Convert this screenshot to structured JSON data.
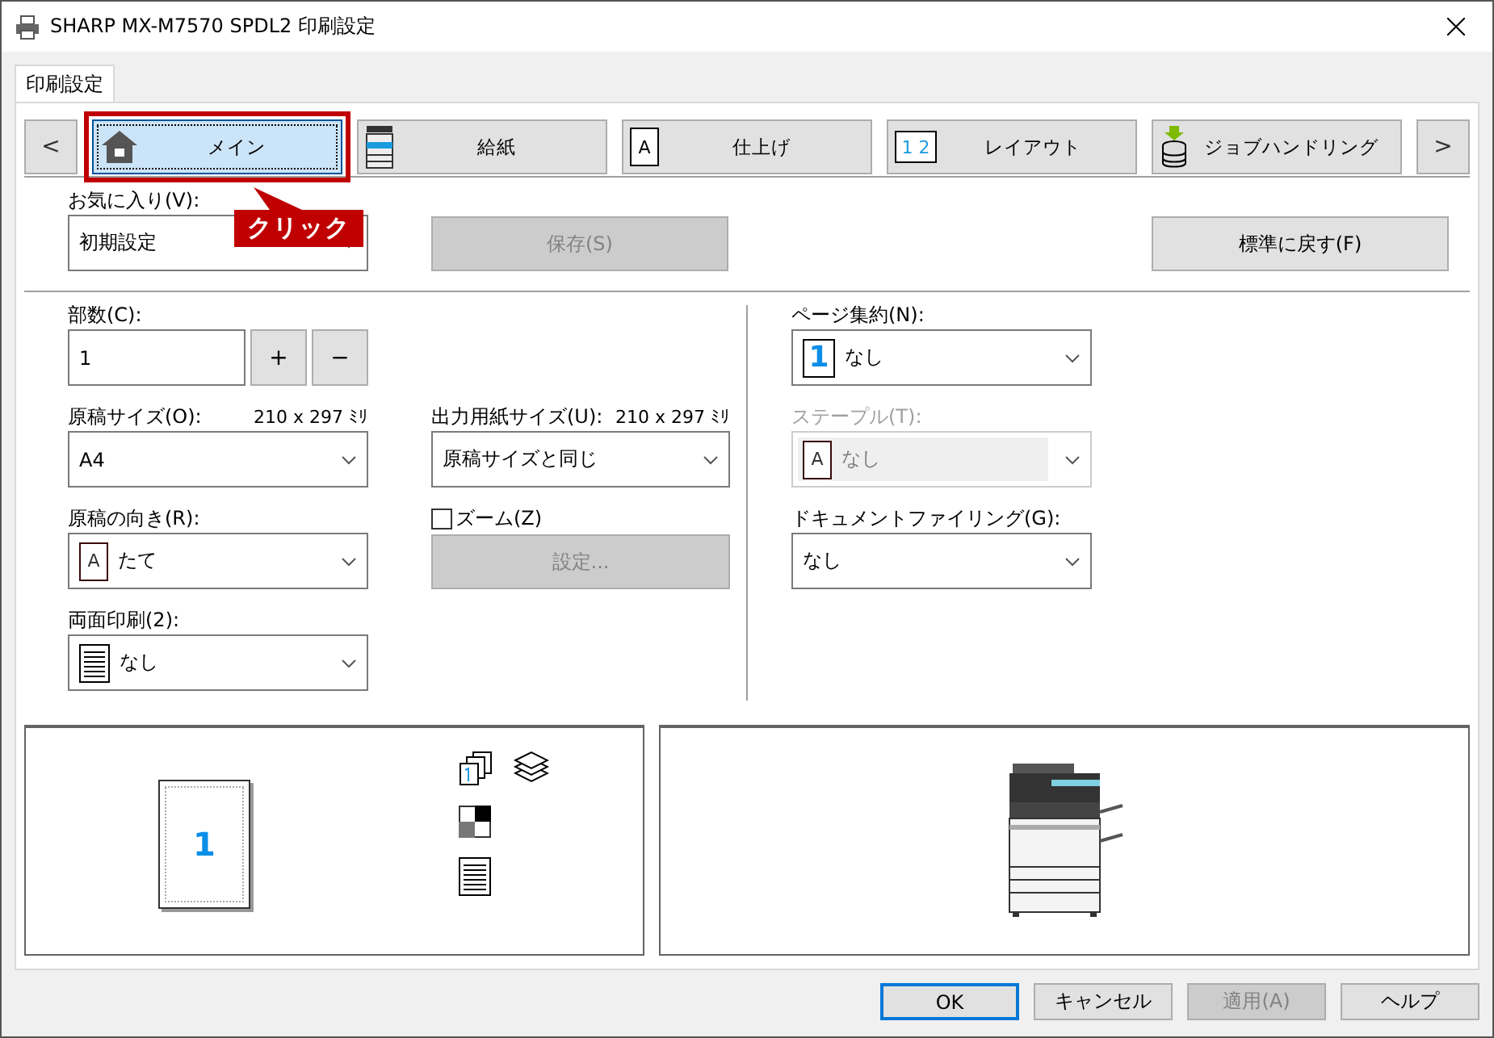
{
  "window": {
    "title": "SHARP MX-M7570 SPDL2 印刷設定"
  },
  "tabs": [
    {
      "label": "印刷設定",
      "selected": true
    }
  ],
  "nav": {
    "prev": "<",
    "next": ">"
  },
  "categories": [
    {
      "label": "メイン",
      "kind": "home",
      "selected": true,
      "highlighted": true
    },
    {
      "label": "給紙",
      "kind": "copier",
      "selected": false,
      "highlighted": false
    },
    {
      "label": "仕上げ",
      "kind": "page",
      "icon_text": "A",
      "selected": false,
      "highlighted": false
    },
    {
      "label": "レイアウト",
      "kind": "layout",
      "icon_text": "1 2",
      "selected": false,
      "highlighted": false
    },
    {
      "label": "ジョブハンドリング",
      "kind": "job",
      "selected": false,
      "highlighted": false
    }
  ],
  "annotation": {
    "text": "クリック"
  },
  "favorites": {
    "label": "お気に入り(V):",
    "value": "初期設定",
    "save": {
      "label": "保存(S)",
      "disabled": true
    },
    "reset": {
      "label": "標準に戻す(F)",
      "disabled": false
    }
  },
  "copies": {
    "label": "部数(C):",
    "value": "1",
    "plus": "+",
    "minus": "−"
  },
  "original_size": {
    "label": "原稿サイズ(O):",
    "size": "210 x 297 ﾐﾘ",
    "value": "A4",
    "disabled": false
  },
  "output_size": {
    "label": "出力用紙サイズ(U):",
    "size": "210 x 297 ﾐﾘ",
    "value": "原稿サイズと同じ",
    "disabled": false
  },
  "orientation": {
    "label": "原稿の向き(R):",
    "value": "たて",
    "kind": "page",
    "icon_text": "A",
    "disabled": false
  },
  "zoom": {
    "label": "ズーム(Z)",
    "checked": false,
    "button": {
      "label": "設定...",
      "disabled": true
    }
  },
  "duplex": {
    "label": "両面印刷(2):",
    "value": "なし",
    "kind": "lines",
    "disabled": false
  },
  "n_up": {
    "label": "ページ集約(N):",
    "value": "なし",
    "kind": "one",
    "icon_text": "1",
    "disabled": false
  },
  "staple": {
    "label": "ステープル(T):",
    "value": "なし",
    "kind": "page",
    "icon_text": "A",
    "disabled": true
  },
  "filing": {
    "label": "ドキュメントファイリング(G):",
    "value": "なし",
    "disabled": false
  },
  "preview": {
    "page": "1"
  },
  "buttons": [
    {
      "label": "OK",
      "default": true,
      "disabled": false
    },
    {
      "label": "キャンセル",
      "default": false,
      "disabled": false
    },
    {
      "label": "適用(A)",
      "default": false,
      "disabled": true
    },
    {
      "label": "ヘルプ",
      "default": false,
      "disabled": false
    }
  ]
}
